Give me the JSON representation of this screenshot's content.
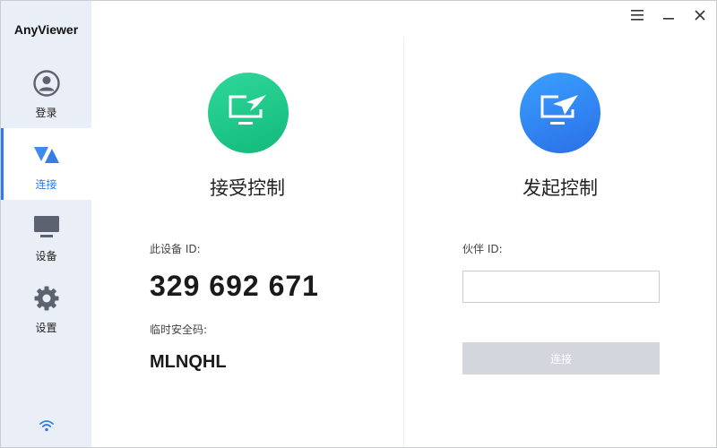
{
  "app": {
    "title": "AnyViewer"
  },
  "sidebar": {
    "items": [
      {
        "label": "登录",
        "icon": "user-icon",
        "active": false
      },
      {
        "label": "连接",
        "icon": "connect-icon",
        "active": true
      },
      {
        "label": "设备",
        "icon": "monitor-icon",
        "active": false
      },
      {
        "label": "设置",
        "icon": "gear-icon",
        "active": false
      }
    ],
    "status_icon": "wifi-icon"
  },
  "window_controls": {
    "menu": "menu-icon",
    "minimize": "minimize-icon",
    "close": "close-icon"
  },
  "accept_panel": {
    "title": "接受控制",
    "device_id_label": "此设备 ID:",
    "device_id": "329 692 671",
    "temp_code_label": "临时安全码:",
    "temp_code": "MLNQHL",
    "icon": "receive-control-icon",
    "color": "#1fc98a"
  },
  "initiate_panel": {
    "title": "发起控制",
    "partner_id_label": "伙伴 ID:",
    "partner_id_value": "",
    "partner_id_placeholder": "",
    "connect_label": "连接",
    "icon": "send-control-icon",
    "color": "#2f86f0"
  },
  "colors": {
    "accent": "#2f7be8",
    "sidebar_bg": "#eaeef6",
    "button_disabled": "#d3d6dc"
  }
}
